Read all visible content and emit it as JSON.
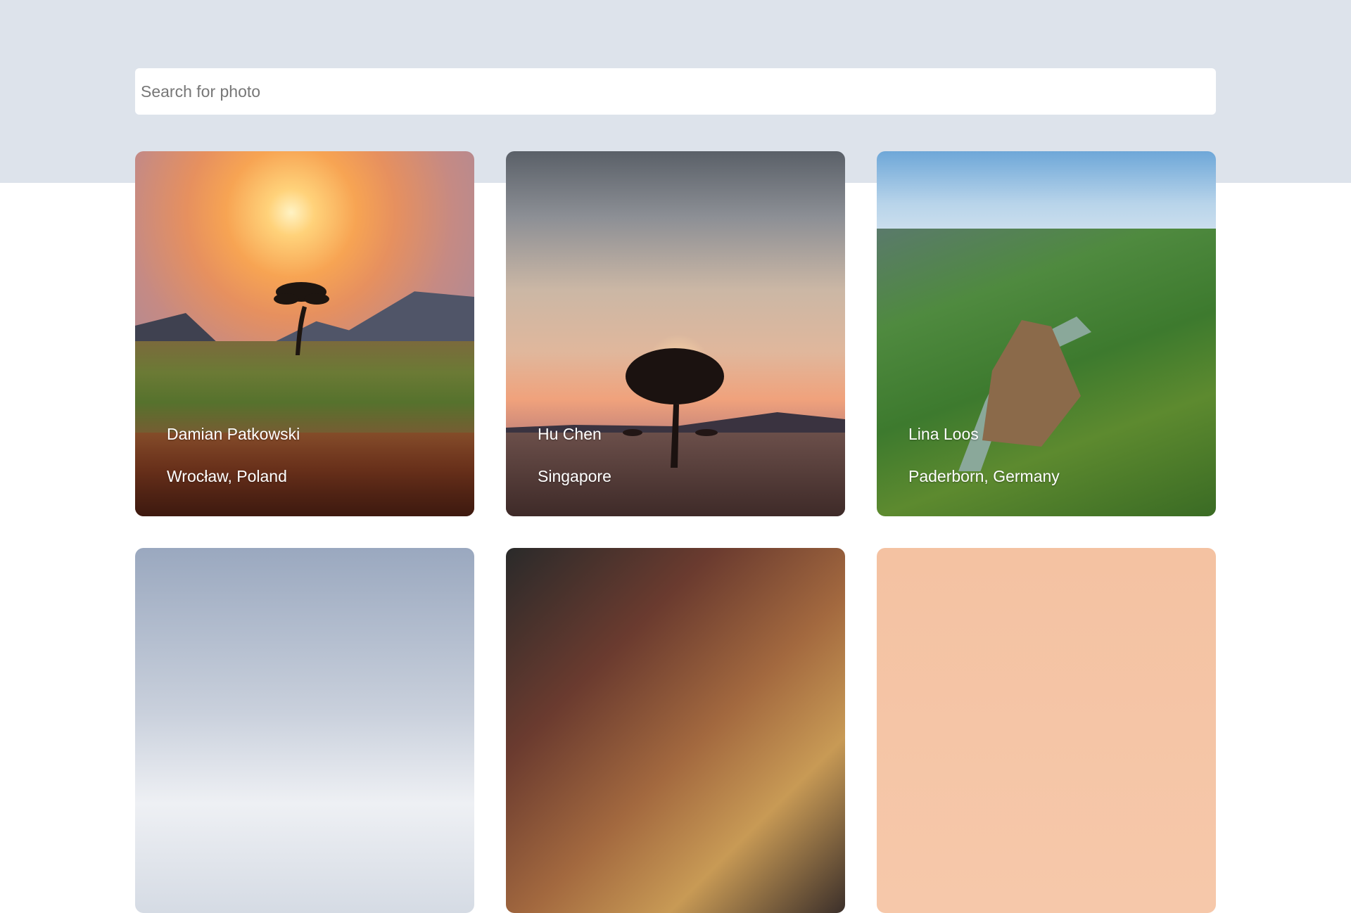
{
  "search": {
    "placeholder": "Search for photo",
    "value": ""
  },
  "photos": [
    {
      "author": "Damian Patkowski",
      "location": "Wrocław, Poland",
      "scene": "savanna-sunset"
    },
    {
      "author": "Hu Chen",
      "location": "Singapore",
      "scene": "acacia-twilight"
    },
    {
      "author": "Lina Loos",
      "location": "Paderborn, Germany",
      "scene": "green-canyon"
    },
    {
      "author": "",
      "location": "",
      "scene": "cloudy-sky"
    },
    {
      "author": "",
      "location": "",
      "scene": "people-crowd"
    },
    {
      "author": "",
      "location": "",
      "scene": "peach-sky"
    }
  ],
  "colors": {
    "header_band": "#dde3eb",
    "page_background": "#ffffff",
    "caption_text": "#ffffff"
  }
}
